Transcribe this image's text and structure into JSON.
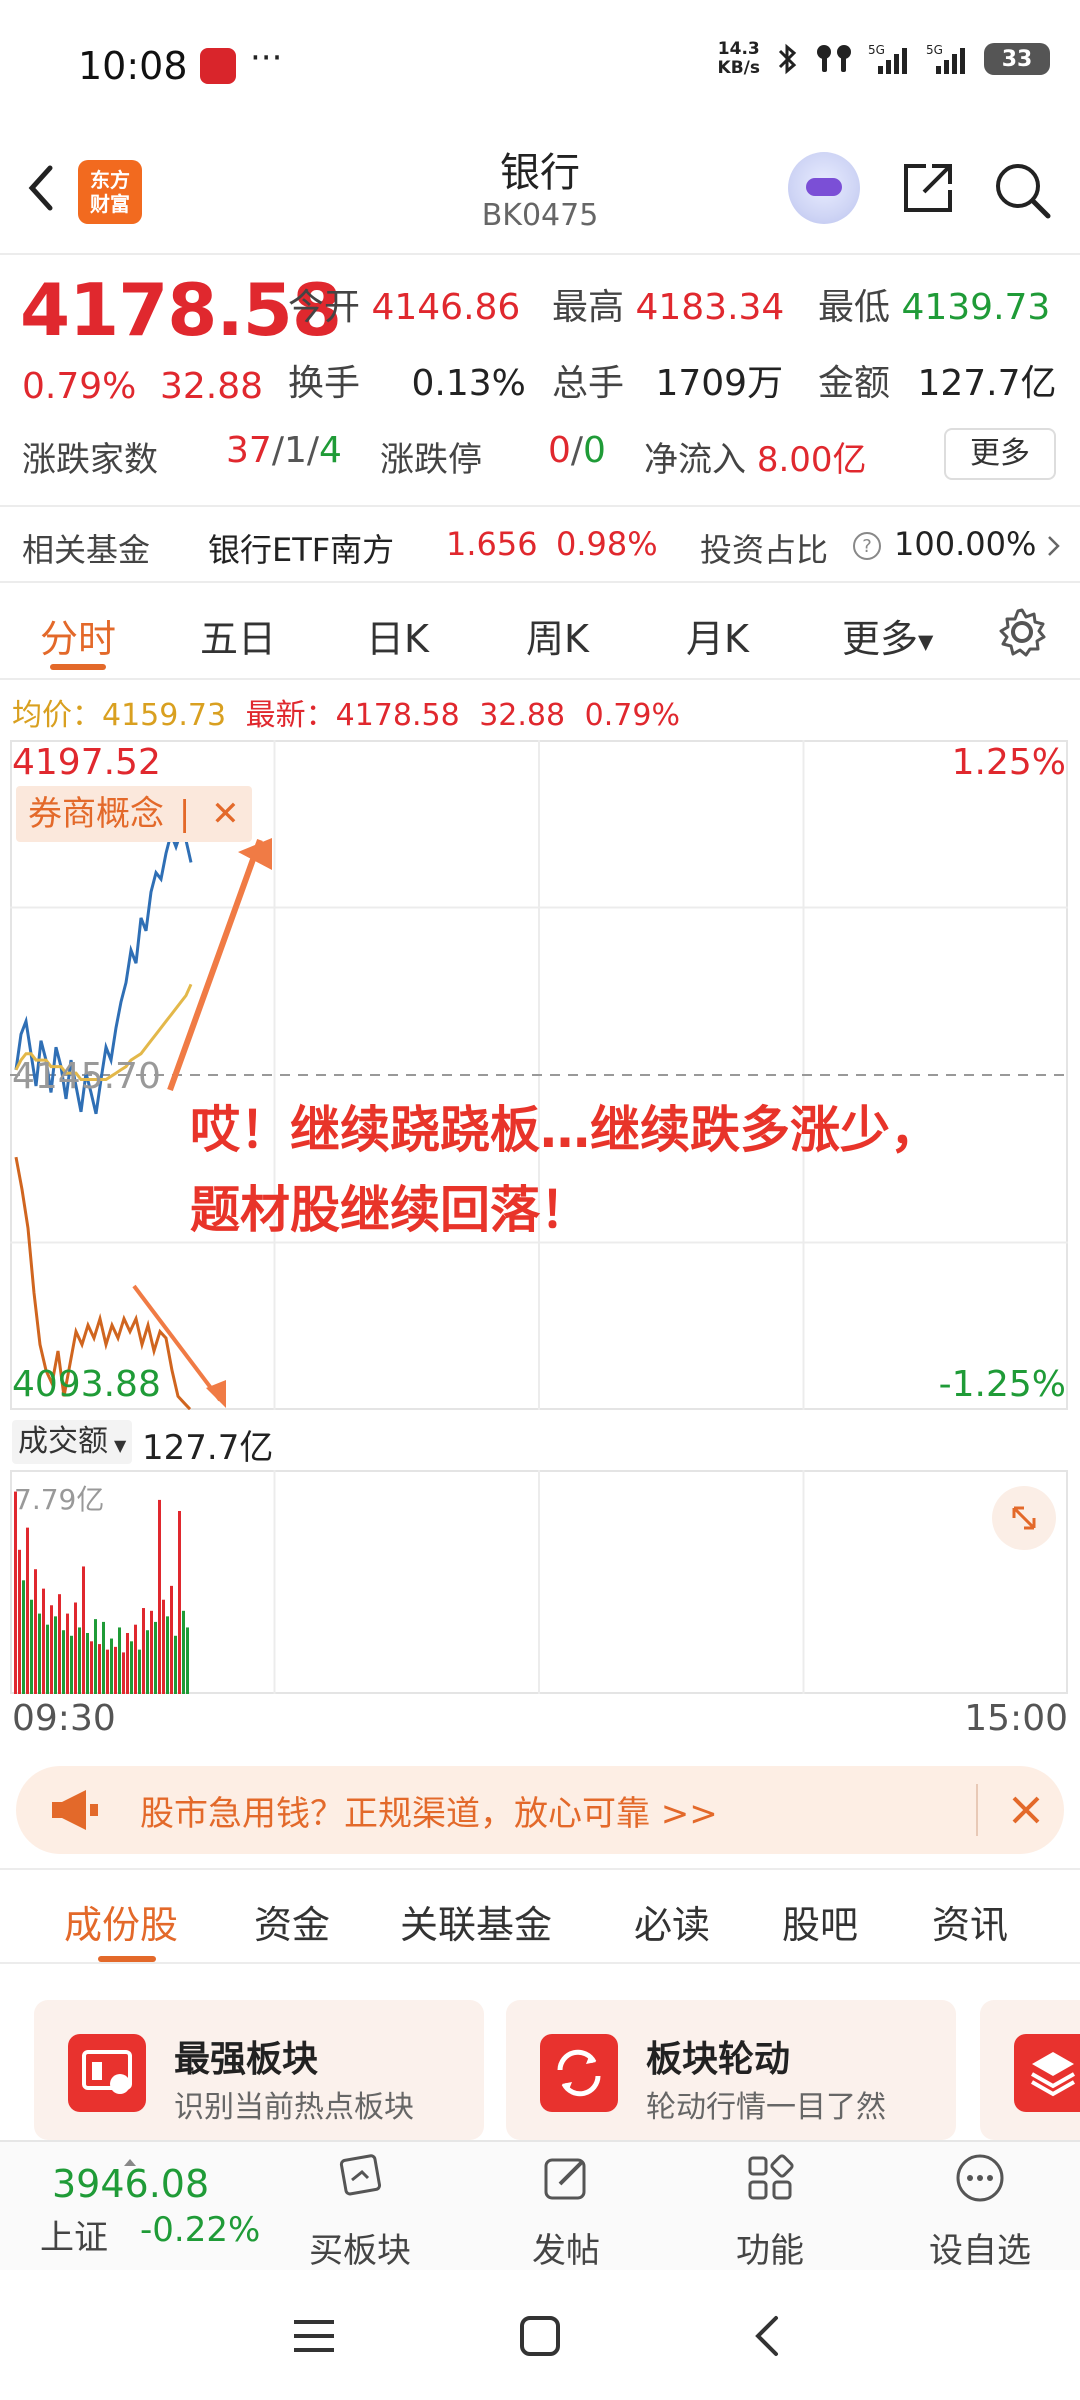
{
  "status_bar": {
    "time": "10:08",
    "dots": "···",
    "net_speed_value": "14.3",
    "net_speed_unit": "KB/s",
    "battery": "33",
    "icons": [
      "bluetooth-icon",
      "earbuds-icon",
      "signal-5g-icon",
      "signal-5g-icon",
      "battery-icon"
    ]
  },
  "header": {
    "logo_text_line1": "东方",
    "logo_text_line2": "财富",
    "title": "银行",
    "code": "BK0475"
  },
  "quote": {
    "price": "4178.58",
    "change_pct": "0.79%",
    "change": "32.88",
    "open_label": "今开",
    "open": "4146.86",
    "high_label": "最高",
    "high": "4183.34",
    "low_label": "最低",
    "low": "4139.73",
    "turnover_label": "换手",
    "turnover": "0.13%",
    "volume_label": "总手",
    "volume": "1709万",
    "amount_label": "金额",
    "amount": "127.7亿",
    "updown_label": "涨跌家数",
    "up": "37",
    "flat": "1",
    "down": "4",
    "limit_label": "涨跌停",
    "limit_up": "0",
    "limit_down": "0",
    "netflow_label": "净流入",
    "netflow": "8.00亿",
    "more_label": "更多"
  },
  "fund_row": {
    "label": "相关基金",
    "fund_name": "银行ETF南方",
    "fund_price": "1.656",
    "fund_pct": "0.98%",
    "ratio_label": "投资占比",
    "ratio": "100.00%"
  },
  "tabs": [
    "分时",
    "五日",
    "日K",
    "周K",
    "月K",
    "更多"
  ],
  "avg_row": {
    "avg_label": "均价：",
    "avg_value": "4159.73",
    "latest_label": "最新：",
    "latest_value": "4178.58",
    "latest_change": "32.88",
    "latest_pct": "0.79%"
  },
  "chart_data": {
    "type": "line",
    "y_top_label": "4197.52",
    "y_mid_label": "4145.70",
    "y_bottom_label": "4093.88",
    "pct_top_label": "1.25%",
    "pct_bottom_label": "-1.25%",
    "ylim": [
      4093.88,
      4197.52
    ],
    "baseline": 4145.7,
    "x_start_label": "09:30",
    "x_end_label": "15:00",
    "series": [
      {
        "name": "price",
        "color": "#2f6fb5",
        "values": [
          4146.5,
          4152,
          4154,
          4149,
          4144,
          4151,
          4148,
          4143,
          4150,
          4147,
          4142,
          4148,
          4144,
          4140,
          4146,
          4143,
          4139.7,
          4145,
          4150,
          4148,
          4153,
          4157,
          4160,
          4165,
          4163,
          4170,
          4168,
          4174,
          4177,
          4176,
          4180,
          4183,
          4181,
          4183.3,
          4182,
          4178.58
        ]
      },
      {
        "name": "avg",
        "color": "#e3b84a",
        "values": [
          4146.5,
          4148,
          4149,
          4149,
          4148,
          4148,
          4148,
          4147,
          4147,
          4147,
          4146,
          4146,
          4146,
          4145,
          4145,
          4145,
          4145,
          4145,
          4145,
          4145.5,
          4146,
          4146.5,
          4147,
          4148,
          4148.5,
          4149,
          4150,
          4151,
          4152,
          4153,
          4154,
          4155,
          4156,
          4157,
          4158,
          4159.73
        ]
      }
    ],
    "tag_label": "券商概念",
    "annotation_line1": "哎！继续跷跷板…继续跌多涨少，",
    "annotation_line2": "题材股继续回落！",
    "secondary_series_values": [
      4133,
      4128,
      4122,
      4112,
      4104,
      4100,
      4098,
      4103,
      4096,
      4101,
      4106,
      4104,
      4107,
      4105,
      4108,
      4104,
      4107,
      4105,
      4108,
      4106,
      4108,
      4104,
      4107,
      4103,
      4106,
      4105,
      4100,
      4096,
      4095,
      4094
    ]
  },
  "volume": {
    "label": "成交额",
    "value": "127.7亿",
    "max_label": "7.79亿",
    "bars": [
      {
        "v": 7.3,
        "c": "red"
      },
      {
        "v": 5.2,
        "c": "red"
      },
      {
        "v": 4.1,
        "c": "green"
      },
      {
        "v": 6.0,
        "c": "red"
      },
      {
        "v": 3.4,
        "c": "green"
      },
      {
        "v": 4.5,
        "c": "red"
      },
      {
        "v": 2.9,
        "c": "green"
      },
      {
        "v": 3.8,
        "c": "red"
      },
      {
        "v": 2.5,
        "c": "green"
      },
      {
        "v": 3.2,
        "c": "red"
      },
      {
        "v": 2.8,
        "c": "green"
      },
      {
        "v": 3.6,
        "c": "red"
      },
      {
        "v": 2.3,
        "c": "green"
      },
      {
        "v": 2.9,
        "c": "red"
      },
      {
        "v": 2.1,
        "c": "green"
      },
      {
        "v": 3.3,
        "c": "red"
      },
      {
        "v": 2.4,
        "c": "green"
      },
      {
        "v": 4.6,
        "c": "red"
      },
      {
        "v": 2.2,
        "c": "green"
      },
      {
        "v": 1.9,
        "c": "red"
      },
      {
        "v": 2.7,
        "c": "green"
      },
      {
        "v": 1.8,
        "c": "red"
      },
      {
        "v": 2.6,
        "c": "green"
      },
      {
        "v": 1.6,
        "c": "red"
      },
      {
        "v": 2.0,
        "c": "green"
      },
      {
        "v": 1.7,
        "c": "red"
      },
      {
        "v": 2.4,
        "c": "green"
      },
      {
        "v": 1.5,
        "c": "red"
      },
      {
        "v": 2.2,
        "c": "red"
      },
      {
        "v": 1.9,
        "c": "green"
      },
      {
        "v": 2.5,
        "c": "red"
      },
      {
        "v": 1.6,
        "c": "green"
      },
      {
        "v": 3.1,
        "c": "red"
      },
      {
        "v": 2.3,
        "c": "green"
      },
      {
        "v": 3.0,
        "c": "red"
      },
      {
        "v": 2.6,
        "c": "green"
      },
      {
        "v": 7.0,
        "c": "red"
      },
      {
        "v": 3.4,
        "c": "red"
      },
      {
        "v": 2.8,
        "c": "green"
      },
      {
        "v": 3.9,
        "c": "red"
      },
      {
        "v": 2.1,
        "c": "green"
      },
      {
        "v": 6.6,
        "c": "red"
      },
      {
        "v": 3.0,
        "c": "green"
      },
      {
        "v": 2.4,
        "c": "green"
      }
    ]
  },
  "promo": {
    "text": "股市急用钱？正规渠道，放心可靠 >>"
  },
  "sub_tabs": [
    "成份股",
    "资金",
    "关联基金",
    "必读",
    "股吧",
    "资讯"
  ],
  "cards": [
    {
      "title": "最强板块",
      "desc": "识别当前热点板块"
    },
    {
      "title": "板块轮动",
      "desc": "轮动行情一目了然"
    }
  ],
  "bottom_bar": {
    "index_value": "3946.08",
    "index_name": "上证",
    "index_pct": "-0.22%",
    "buy_label": "买板块",
    "post_label": "发帖",
    "func_label": "功能",
    "watch_label": "设自选"
  },
  "colors": {
    "up": "#e0282e",
    "down": "#1f9b37",
    "accent": "#e3692a",
    "price_line": "#2f6fb5",
    "avg_line": "#e3b84a"
  }
}
